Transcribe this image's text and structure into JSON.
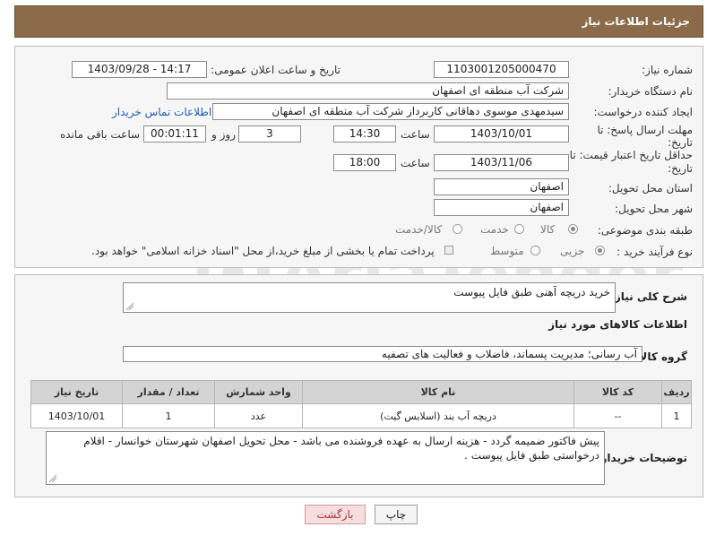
{
  "header": {
    "title": "جزئیات اطلاعات نیاز"
  },
  "form": {
    "need_number": {
      "label": "شماره نیاز:",
      "value": "1103001205000470"
    },
    "announce_datetime": {
      "label": "تاریخ و ساعت اعلان عمومی:",
      "value": "1403/09/28 - 14:17"
    },
    "buyer_org": {
      "label": "نام دستگاه خریدار:",
      "value": "شرکت آب منطقه ای اصفهان"
    },
    "requester": {
      "label": "ایجاد کننده درخواست:",
      "value": "سیدمهدی موسوی دهاقانی کاربرداز شرکت آب منطقه ای اصفهان",
      "contact_link": "اطلاعات تماس خریدار"
    },
    "response_deadline": {
      "label_line1": "مهلت ارسال پاسخ: تا",
      "label_line2": "تاریخ:",
      "date": "1403/10/01",
      "time_label": "ساعت",
      "time": "14:30",
      "days": "3",
      "days_label": "روز و",
      "remaining": "00:01:11",
      "remaining_label": "ساعت باقی مانده"
    },
    "price_validity": {
      "label_line1": "حداقل تاریخ اعتبار قیمت: تا",
      "label_line2": "تاریخ:",
      "date": "1403/11/06",
      "time_label": "ساعت",
      "time": "18:00"
    },
    "province": {
      "label": "استان محل تحویل:",
      "value": "اصفهان"
    },
    "city": {
      "label": "شهر محل تحویل:",
      "value": "اصفهان"
    },
    "category": {
      "label": "طبقه بندی موضوعی:",
      "options": [
        "کالا",
        "خدمت",
        "کالا/خدمت"
      ],
      "selected": "کالا"
    },
    "purchase_type": {
      "label": "نوع فرآیند خرید :",
      "options": [
        "جزیی",
        "متوسط"
      ],
      "selected": "جزیی",
      "checkbox_label": "پرداخت تمام یا بخشی از مبلغ خرید،از محل \"اسناد خزانه اسلامی\" خواهد بود."
    }
  },
  "description": {
    "label": "شرح کلی نیاز:",
    "value": "خرید دریچه آهنی طبق فایل پیوست"
  },
  "goods_info_title": "اطلاعات کالاهای مورد نیاز",
  "goods_group": {
    "label": "گروه کالا:",
    "value": "آب رسانی؛ مدیریت پسماند، فاضلاب و فعالیت های تصفیه"
  },
  "table": {
    "headers": [
      "ردیف",
      "کد کالا",
      "نام کالا",
      "واحد شمارش",
      "تعداد / مقدار",
      "تاریخ نیاز"
    ],
    "rows": [
      [
        "1",
        "--",
        "دریچه آب بند (اسلایس گیت)",
        "عدد",
        "1",
        "1403/10/01"
      ]
    ]
  },
  "buyer_notes": {
    "label": "توضیحات خریدار:",
    "value": "پیش فاکتور ضمیمه گردد - هزینه ارسال به عهده فروشنده می باشد - محل تحویل اصفهان شهرستان خوانسار - اقلام درخواستی طبق فایل پیوست ."
  },
  "buttons": {
    "print": "چاپ",
    "back": "بازگشت"
  },
  "watermark": "AriaTender.net"
}
